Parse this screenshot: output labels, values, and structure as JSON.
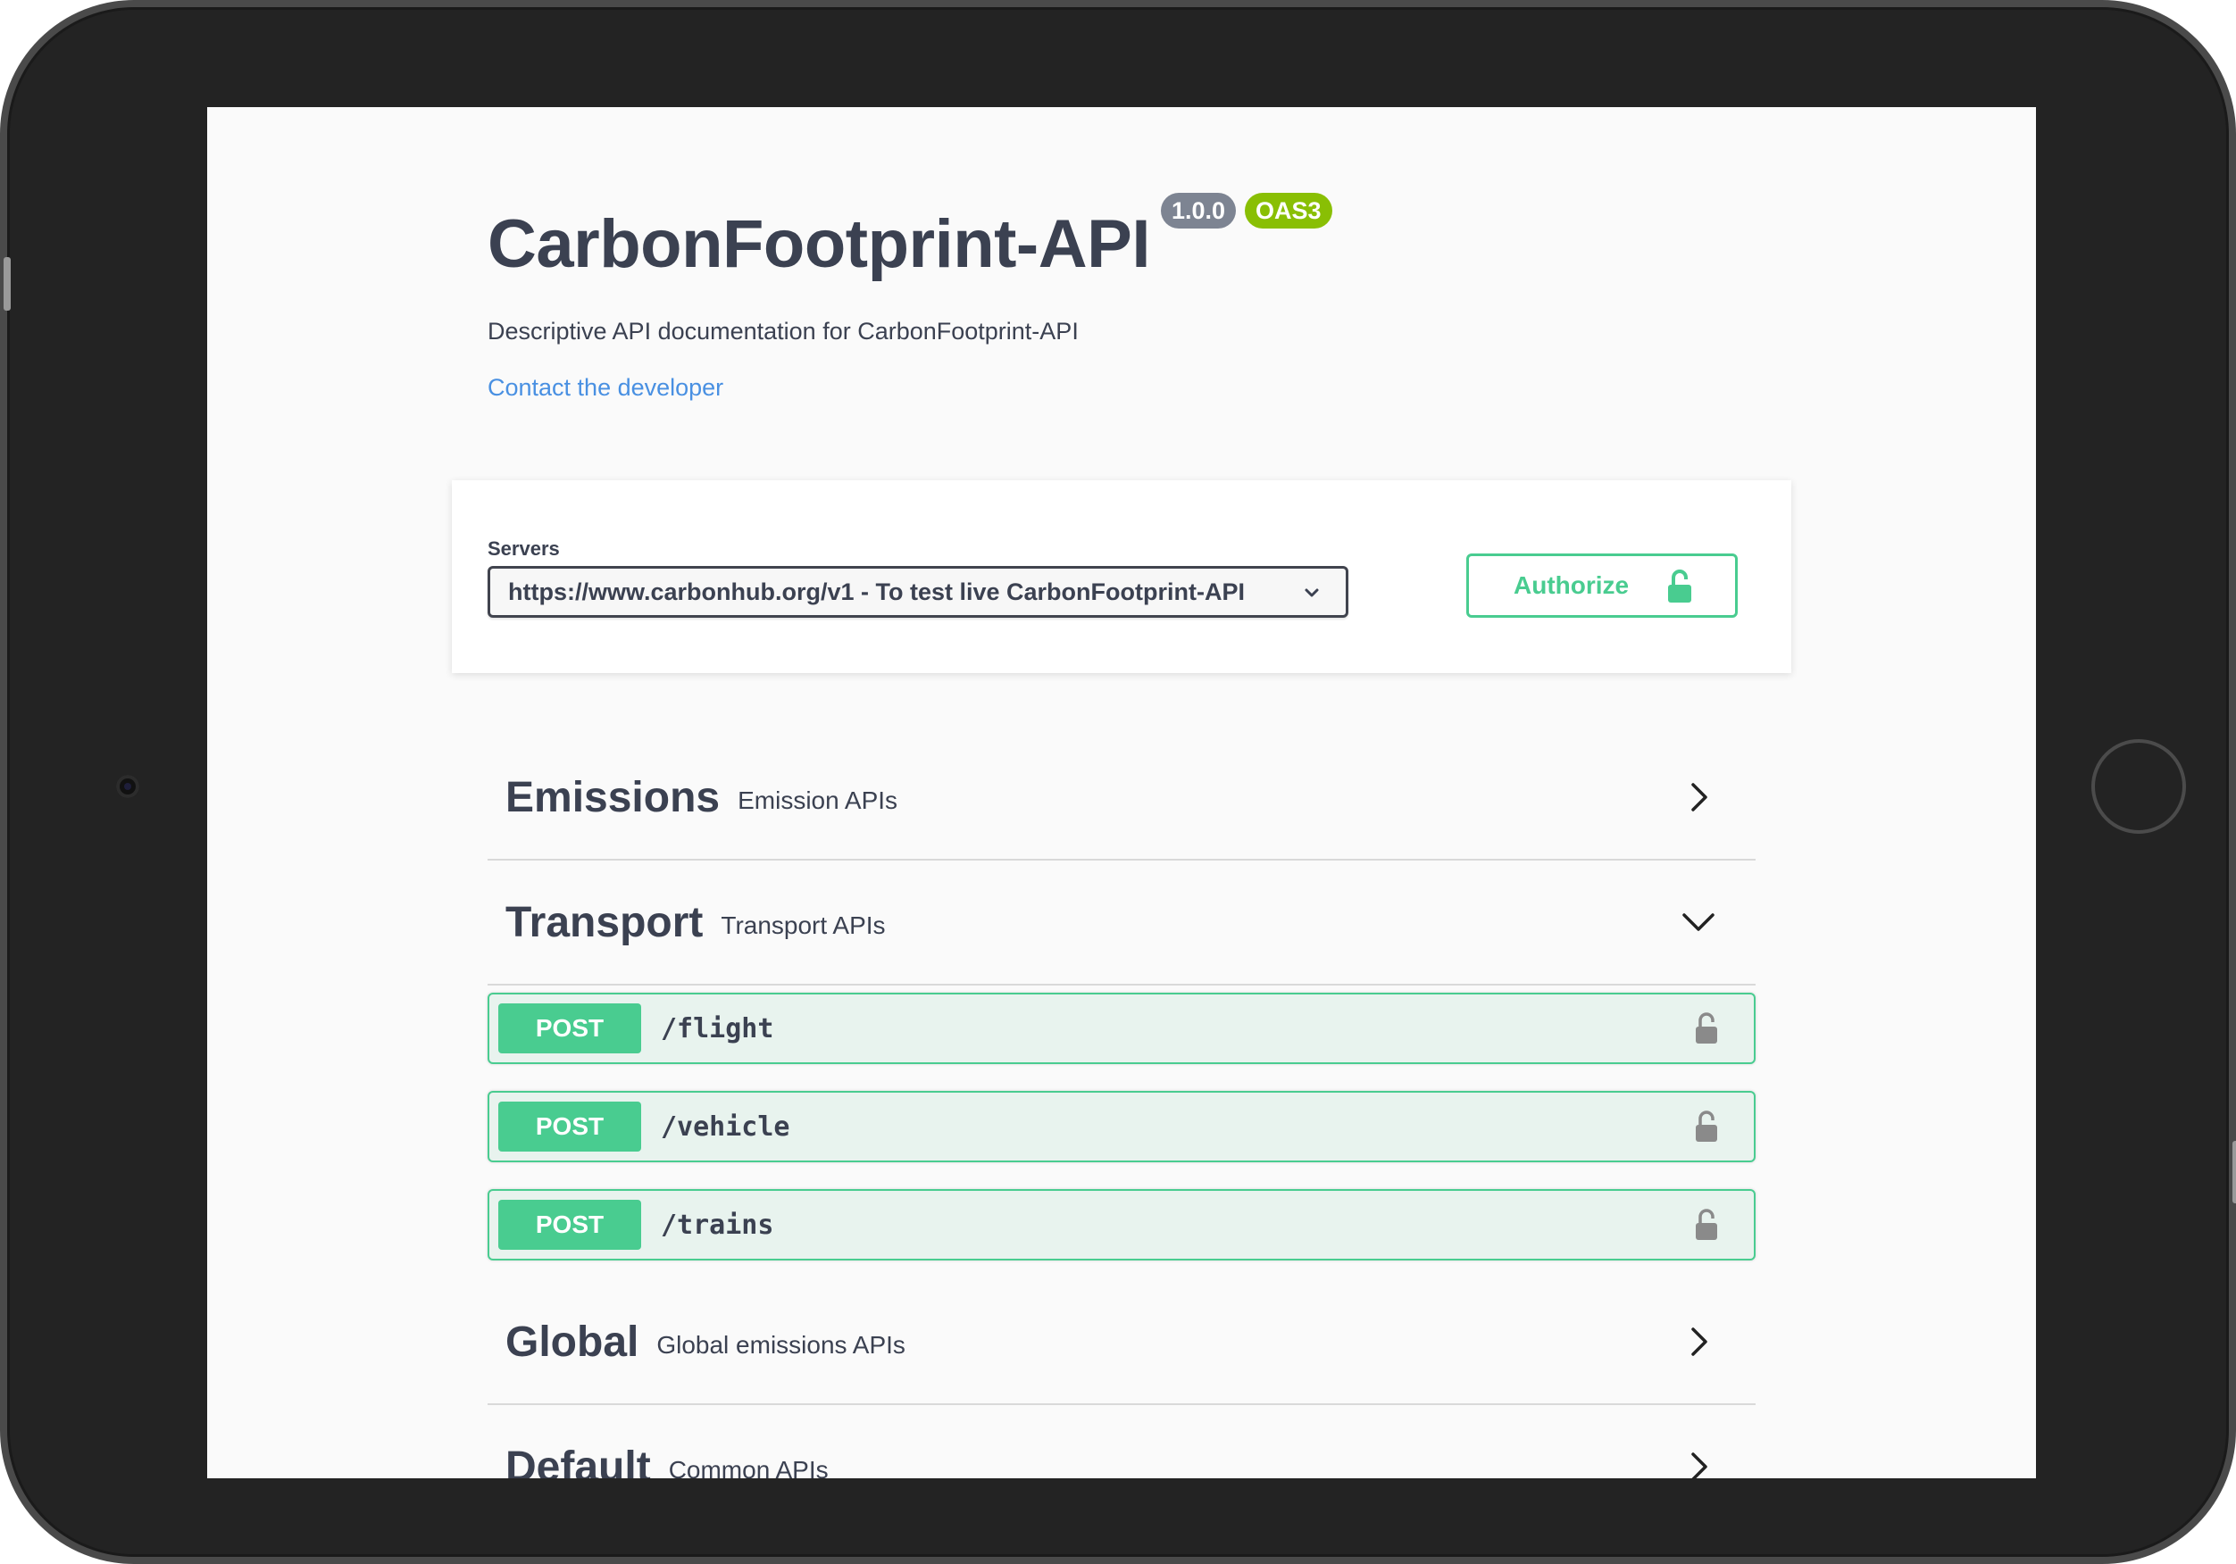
{
  "info": {
    "title": "CarbonFootprint-API",
    "version": "1.0.0",
    "oas_badge": "OAS3",
    "description": "Descriptive API documentation for CarbonFootprint-API",
    "contact_link": "Contact the developer"
  },
  "servers": {
    "label": "Servers",
    "selected": "https://www.carbonhub.org/v1 - To test live CarbonFootprint-API"
  },
  "authorize": {
    "label": "Authorize"
  },
  "tags": [
    {
      "name": "Emissions",
      "description": "Emission APIs",
      "expanded": false
    },
    {
      "name": "Transport",
      "description": "Transport APIs",
      "expanded": true
    },
    {
      "name": "Global",
      "description": "Global emissions APIs",
      "expanded": false
    },
    {
      "name": "Default",
      "description": "Common APIs",
      "expanded": false
    }
  ],
  "operations": [
    {
      "method": "POST",
      "path": "/flight"
    },
    {
      "method": "POST",
      "path": "/vehicle"
    },
    {
      "method": "POST",
      "path": "/trains"
    }
  ],
  "colors": {
    "post": "#49cc90",
    "post_bg": "#e8f3ee",
    "link": "#4990e2",
    "version_badge": "#7d8492",
    "oas_badge": "#89bf04",
    "text": "#3b4151"
  }
}
